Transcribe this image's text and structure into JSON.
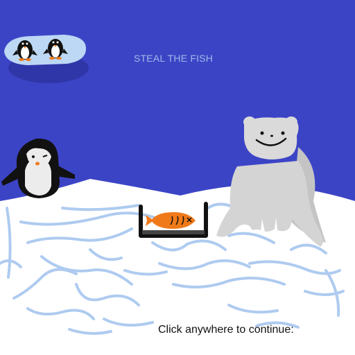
{
  "game": {
    "title": "STEAL THE FISH",
    "prompt": "Click anywhere to continue:"
  },
  "colors": {
    "sky": "#3c44c6",
    "title_text": "#9dbbe6",
    "ice_floe": "#bcd8f4",
    "snow": "#ffffff",
    "ice_cracks": "#aecbf0",
    "polar_bear": "#d4d4d4",
    "fish": "#f07a1a",
    "trap_frame": "#111111"
  },
  "icons": [
    "penguin-icon",
    "polar-bear-icon",
    "fish-icon",
    "trap-icon"
  ]
}
